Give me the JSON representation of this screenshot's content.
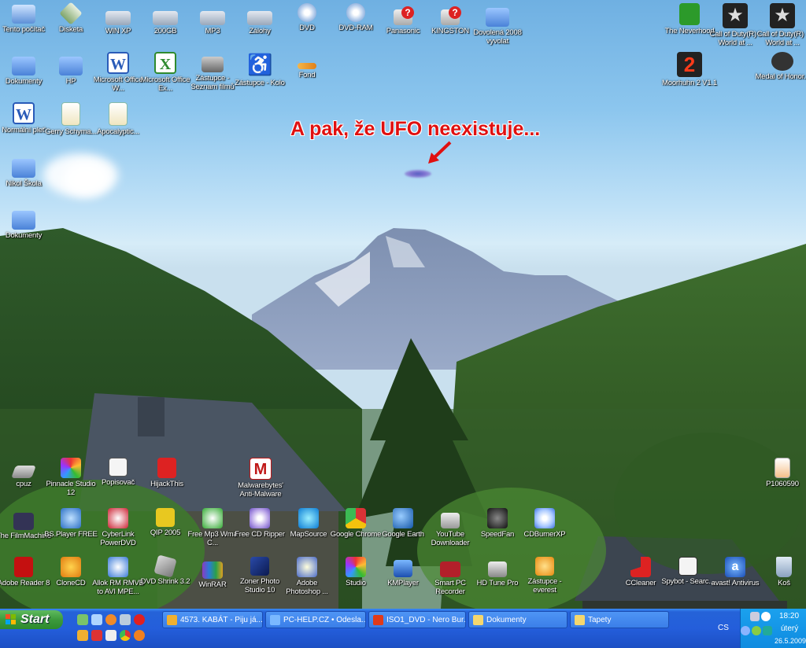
{
  "caption": "A pak, že UFO neexistuje...",
  "desktop_icons": [
    {
      "label": "Tento počítač",
      "icon": "computer-icon"
    },
    {
      "label": "Disketa",
      "icon": "floppy-icon"
    },
    {
      "label": "WIN XP",
      "icon": "drive-icon"
    },
    {
      "label": "200GB",
      "icon": "drive-icon"
    },
    {
      "label": "MP3",
      "icon": "drive-icon"
    },
    {
      "label": "Zálohy",
      "icon": "drive-icon"
    },
    {
      "label": "DVD",
      "icon": "dvd-drive-icon"
    },
    {
      "label": "DVD-RAM",
      "icon": "dvd-drive-icon"
    },
    {
      "label": "Panasonic",
      "icon": "removable-drive-icon"
    },
    {
      "label": "KINGSTON",
      "icon": "removable-drive-icon"
    },
    {
      "label": "Dovolená 2008 vyvolat",
      "icon": "folder-icon"
    },
    {
      "label": "The Neverhood",
      "icon": "neverhood-icon"
    },
    {
      "label": "Call of Duty(R) - World at ...",
      "icon": "cod-icon"
    },
    {
      "label": "Call of Duty(R) - World at ...",
      "icon": "cod-icon"
    },
    {
      "label": "Dokumenty",
      "icon": "documents-folder-icon"
    },
    {
      "label": "HP",
      "icon": "folder-icon"
    },
    {
      "label": "Microsoft Office W...",
      "icon": "word-icon"
    },
    {
      "label": "Microsoft Office Ex...",
      "icon": "excel-icon"
    },
    {
      "label": "Zástupce - Seznam filmů",
      "icon": "camera-icon"
    },
    {
      "label": "Zástupce - Kolo",
      "icon": "accessibility-icon"
    },
    {
      "label": "Fond",
      "icon": "fond-icon"
    },
    {
      "label": "Moorhuhn 2 V1.1",
      "icon": "moorhuhn-icon"
    },
    {
      "label": "Medal of Honor...",
      "icon": "medal-icon"
    },
    {
      "label": "Normální plet'",
      "icon": "word-doc-icon"
    },
    {
      "label": "Gerry Schyma...",
      "icon": "script-icon"
    },
    {
      "label": "Apocalyptic...",
      "icon": "script-icon"
    },
    {
      "label": "Nikol Škola",
      "icon": "folder-icon"
    },
    {
      "label": "Dokumenty",
      "icon": "folder-icon"
    },
    {
      "label": "cpuz",
      "icon": "cpuz-icon"
    },
    {
      "label": "Pinnacle Studio 12",
      "icon": "pinnacle-icon"
    },
    {
      "label": "Popisovač",
      "icon": "popisovac-icon"
    },
    {
      "label": "HijackThis",
      "icon": "hijackthis-icon"
    },
    {
      "label": "Malwarebytes' Anti-Malware",
      "icon": "malwarebytes-icon"
    },
    {
      "label": "P1060590",
      "icon": "image-file-icon"
    },
    {
      "label": "The FilmMachine",
      "icon": "filmmachine-icon"
    },
    {
      "label": "BS.Player FREE",
      "icon": "bsplayer-icon"
    },
    {
      "label": "CyberLink PowerDVD",
      "icon": "powerdvd-icon"
    },
    {
      "label": "QIP 2005",
      "icon": "qip-icon"
    },
    {
      "label": "Free Mp3 Wma C...",
      "icon": "mp3-converter-icon"
    },
    {
      "label": "Free CD Ripper",
      "icon": "cd-ripper-icon"
    },
    {
      "label": "MapSource",
      "icon": "mapsource-icon"
    },
    {
      "label": "Google Chrome",
      "icon": "chrome-icon"
    },
    {
      "label": "Google Earth",
      "icon": "google-earth-icon"
    },
    {
      "label": "YouTube Downloader",
      "icon": "youtube-downloader-icon"
    },
    {
      "label": "SpeedFan",
      "icon": "speedfan-icon"
    },
    {
      "label": "CDBurnerXP",
      "icon": "cdburner-icon"
    },
    {
      "label": "Adobe Reader 8",
      "icon": "adobe-reader-icon"
    },
    {
      "label": "CloneCD",
      "icon": "clonecd-icon"
    },
    {
      "label": "Allok RM RMVB to AVI MPE...",
      "icon": "allok-icon"
    },
    {
      "label": "DVD Shrink 3.2",
      "icon": "dvdshrink-icon"
    },
    {
      "label": "WinRAR",
      "icon": "winrar-icon"
    },
    {
      "label": "Zoner Photo Studio 10",
      "icon": "zoner-icon"
    },
    {
      "label": "Adobe Photoshop ...",
      "icon": "photoshop-icon"
    },
    {
      "label": "Studio",
      "icon": "studio-icon"
    },
    {
      "label": "KMPlayer",
      "icon": "kmplayer-icon"
    },
    {
      "label": "Smart PC Recorder",
      "icon": "recorder-icon"
    },
    {
      "label": "HD Tune Pro",
      "icon": "hdtune-icon"
    },
    {
      "label": "Zástupce - everest",
      "icon": "everest-icon"
    },
    {
      "label": "CCleaner",
      "icon": "ccleaner-icon"
    },
    {
      "label": "Spybot - Searc...",
      "icon": "spybot-icon"
    },
    {
      "label": "avast! Antivirus",
      "icon": "avast-icon"
    },
    {
      "label": "Koš",
      "icon": "recycle-bin-icon"
    }
  ],
  "taskbar": {
    "start_label": "Start",
    "quick_launch": [
      "show-desktop-icon",
      "ie-icon",
      "firefox-icon",
      "network-icon",
      "opera-icon",
      "winamp-icon",
      "save-icon",
      "notes-icon",
      "chrome-icon",
      "avast-icon"
    ],
    "tasks": [
      {
        "label": "4573. KABÁT - Piju já...",
        "icon": "winamp-task-icon"
      },
      {
        "label": "PC-HELP.CZ • Odesla...",
        "icon": "ie-task-icon"
      },
      {
        "label": "ISO1_DVD - Nero Bur...",
        "icon": "nero-task-icon"
      },
      {
        "label": "Dokumenty",
        "icon": "folder-task-icon"
      },
      {
        "label": "Tapety",
        "icon": "folder-task-icon"
      }
    ],
    "language": "CS",
    "clock_time": "18:20",
    "clock_day": "úterý",
    "clock_date": "26.5.2009"
  },
  "colors": {
    "caption": "#e01010",
    "taskbar": "#245edb",
    "start": "#3c9a3c"
  }
}
